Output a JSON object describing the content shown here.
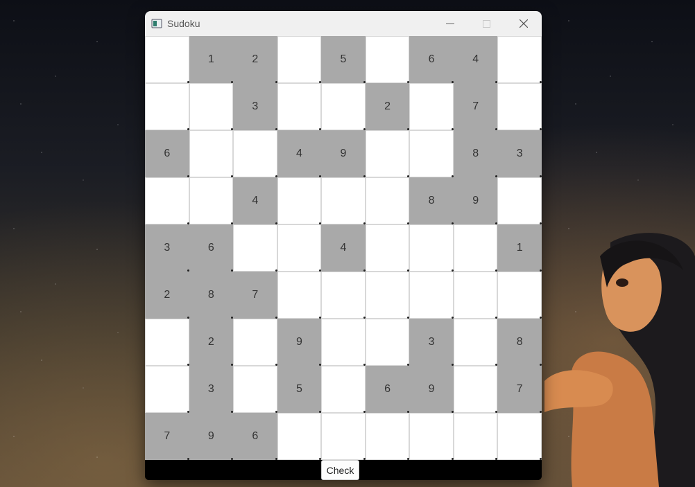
{
  "window": {
    "title": "Sudoku",
    "icons": {
      "app": "sudoku-app-icon",
      "minimize": "minimize-icon",
      "maximize": "maximize-icon",
      "close": "close-icon"
    }
  },
  "board": {
    "rows": [
      [
        "",
        "1",
        "2",
        "",
        "5",
        "",
        "6",
        "4",
        ""
      ],
      [
        "",
        "",
        "3",
        "",
        "",
        "2",
        "",
        "7",
        ""
      ],
      [
        "6",
        "",
        "",
        "4",
        "9",
        "",
        "",
        "8",
        "3"
      ],
      [
        "",
        "",
        "4",
        "",
        "",
        "",
        "8",
        "9",
        ""
      ],
      [
        "3",
        "6",
        "",
        "",
        "4",
        "",
        "",
        "",
        "1"
      ],
      [
        "2",
        "8",
        "7",
        "",
        "",
        "",
        "",
        "",
        ""
      ],
      [
        "",
        "2",
        "",
        "9",
        "",
        "",
        "3",
        "",
        "8"
      ],
      [
        "",
        "3",
        "",
        "5",
        "",
        "6",
        "9",
        "",
        "7"
      ],
      [
        "7",
        "9",
        "6",
        "",
        "",
        "",
        "",
        "",
        ""
      ]
    ],
    "given_color": "#a9a9a9",
    "empty_color": "#ffffff"
  },
  "footer": {
    "check_label": "Check"
  }
}
